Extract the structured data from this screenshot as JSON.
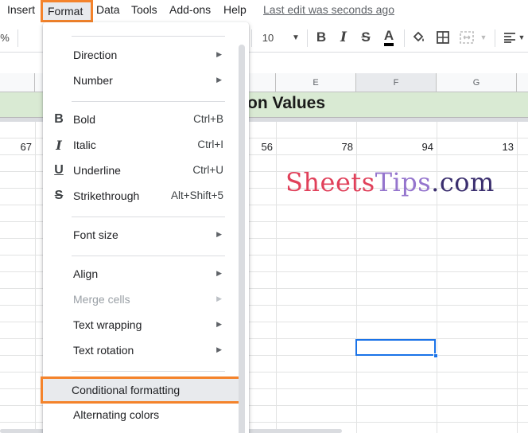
{
  "menubar": {
    "insert": "Insert",
    "format": "Format",
    "data": "Data",
    "tools": "Tools",
    "addons": "Add-ons",
    "help": "Help",
    "last_edit": "Last edit was seconds ago"
  },
  "toolbar": {
    "percent": "%",
    "font_size": "10"
  },
  "sheet": {
    "columns": [
      "E",
      "F",
      "G"
    ],
    "title_fragment": "on Values",
    "row_values": [
      "67",
      "56",
      "78",
      "94",
      "13"
    ]
  },
  "watermark": {
    "part1": "Sheets",
    "part2": "Tips",
    "part3": ".com"
  },
  "format_menu": {
    "direction": "Direction",
    "number": "Number",
    "bold": "Bold",
    "bold_shortcut": "Ctrl+B",
    "italic": "Italic",
    "italic_shortcut": "Ctrl+I",
    "underline": "Underline",
    "underline_shortcut": "Ctrl+U",
    "strikethrough": "Strikethrough",
    "strikethrough_shortcut": "Alt+Shift+5",
    "font_size": "Font size",
    "align": "Align",
    "merge_cells": "Merge cells",
    "text_wrapping": "Text wrapping",
    "text_rotation": "Text rotation",
    "conditional_formatting": "Conditional formatting",
    "alternating_colors": "Alternating colors"
  },
  "colors": {
    "highlight_outline": "#f4832b",
    "title_band": "#d9ead3",
    "selection": "#1a73e8"
  }
}
